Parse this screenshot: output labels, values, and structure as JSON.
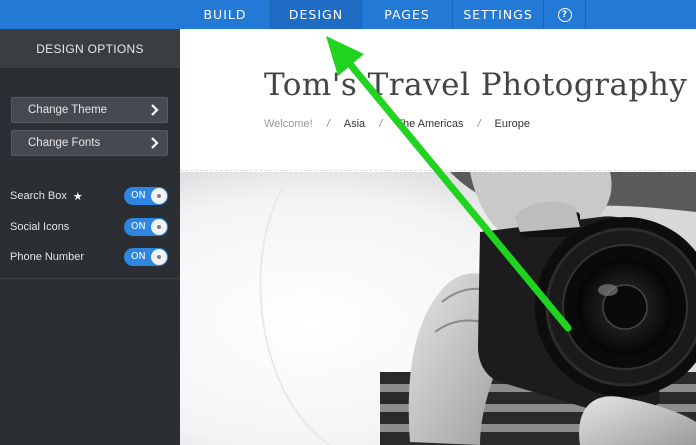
{
  "topbar": {
    "tabs": [
      {
        "label": "BUILD",
        "active": false
      },
      {
        "label": "DESIGN",
        "active": true
      },
      {
        "label": "PAGES",
        "active": false
      },
      {
        "label": "SETTINGS",
        "active": false
      }
    ],
    "help_icon": "?"
  },
  "sidebar": {
    "title": "DESIGN OPTIONS",
    "buttons": [
      {
        "label": "Change Theme",
        "icon": "chevron-right-icon"
      },
      {
        "label": "Change Fonts",
        "icon": "chevron-right-icon"
      }
    ],
    "toggles": [
      {
        "label": "Search Box",
        "state": "ON",
        "has_star": true
      },
      {
        "label": "Social Icons",
        "state": "ON"
      },
      {
        "label": "Phone Number",
        "state": "ON"
      }
    ]
  },
  "site": {
    "title": "Tom's Travel Photography",
    "nav": [
      {
        "label": "Welcome!",
        "muted": true
      },
      {
        "label": "Asia"
      },
      {
        "label": "The Americas"
      },
      {
        "label": "Europe"
      }
    ],
    "nav_separator": "/"
  },
  "colors": {
    "topbar": "#2379d6",
    "sidebar": "#2b2e33",
    "toggle_on": "#2e86e0",
    "annotation_arrow": "#1fd31f"
  }
}
